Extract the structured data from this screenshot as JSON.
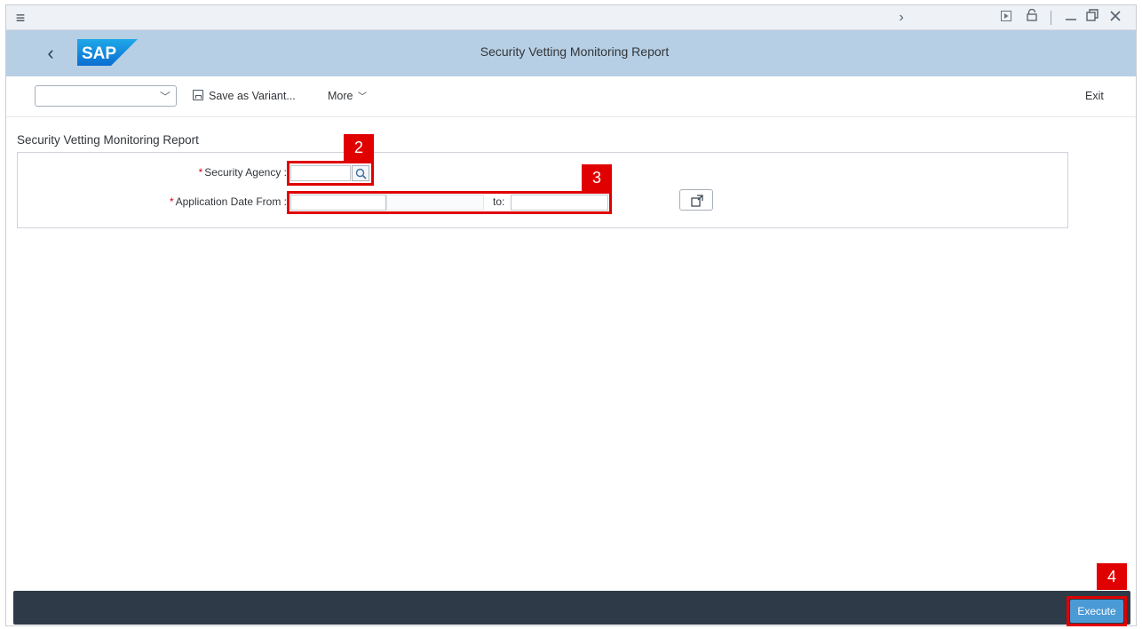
{
  "header": {
    "title": "Security Vetting Monitoring Report",
    "logo_text": "SAP"
  },
  "toolbar": {
    "variant_value": "",
    "save_variant_label": "Save as Variant...",
    "more_label": "More",
    "exit_label": "Exit"
  },
  "form": {
    "section_title": "Security Vetting Monitoring Report",
    "security_agency": {
      "label": "Security Agency :",
      "value": ""
    },
    "application_date": {
      "label": "Application Date From :",
      "from_value": "",
      "to_label": "to:",
      "to_value": ""
    }
  },
  "callouts": {
    "agency": "2",
    "dates": "3",
    "execute": "4"
  },
  "footer": {
    "execute_label": "Execute"
  },
  "colors": {
    "header_bg": "#b7cfe4",
    "footer_bg": "#2e3a47",
    "execute_bg": "#4a9ad6",
    "callout_red": "#e00000",
    "required_red": "#d0021b"
  }
}
